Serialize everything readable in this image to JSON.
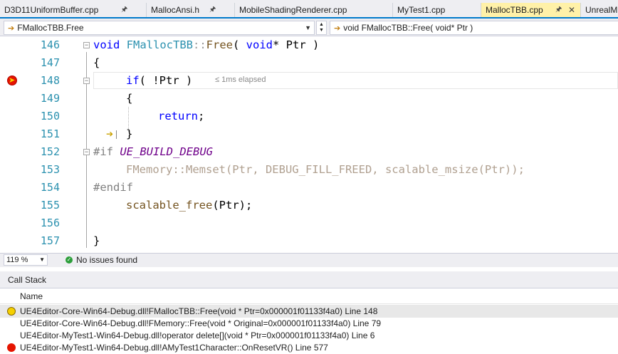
{
  "tabs": [
    {
      "label": "D3D11UniformBuffer.cpp",
      "pinned": true,
      "active": false
    },
    {
      "label": "MallocAnsi.h",
      "pinned": true,
      "active": false
    },
    {
      "label": "MobileShadingRenderer.cpp",
      "pinned": false,
      "active": false
    },
    {
      "label": "MyTest1.cpp",
      "pinned": false,
      "active": false
    },
    {
      "label": "MallocTBB.cpp",
      "pinned": true,
      "active": true
    },
    {
      "label": "UnrealM",
      "pinned": false,
      "active": false
    }
  ],
  "icons": {
    "pin": "pin-icon",
    "close": "close-icon",
    "nav_scope": "arrow-right-icon",
    "dropdown": "chevron-down-icon"
  },
  "nav": {
    "scope": "FMallocTBB.Free",
    "member": "void FMallocTBB::Free( void* Ptr )"
  },
  "editor": {
    "lines": [
      {
        "n": "146"
      },
      {
        "n": "147"
      },
      {
        "n": "148"
      },
      {
        "n": "149"
      },
      {
        "n": "150"
      },
      {
        "n": "151"
      },
      {
        "n": "152"
      },
      {
        "n": "153"
      },
      {
        "n": "154"
      },
      {
        "n": "155"
      },
      {
        "n": "156"
      },
      {
        "n": "157"
      }
    ],
    "elapsed_hint": "≤ 1ms elapsed"
  },
  "code": {
    "l146": {
      "kw1": "void",
      "cls": "FMallocTBB",
      "sep": "::",
      "fn": "Free",
      "rest1": "( ",
      "kw2": "void",
      "rest2": "* Ptr )"
    },
    "l147": "{",
    "l148": {
      "kw": "if",
      "rest": "( !Ptr )"
    },
    "l149": "{",
    "l150": {
      "kw": "return",
      "rest": ";"
    },
    "l151": "}",
    "l152": {
      "pre": "#if",
      "mac": "UE_BUILD_DEBUG"
    },
    "l153": "FMemory::Memset(Ptr, DEBUG_FILL_FREED, scalable_msize(Ptr));",
    "l154": "#endif",
    "l155": {
      "fn": "scalable_free",
      "rest": "(Ptr);"
    },
    "l157": "}"
  },
  "status": {
    "zoom": "119 %",
    "issues": "No issues found"
  },
  "colors": {
    "accent": "#007acc",
    "active_tab": "#fff1a8",
    "keyword": "#0000ff",
    "type": "#2b91af",
    "breakpoint": "#e51400",
    "current": "#f5d000"
  },
  "callstack": {
    "title": "Call Stack",
    "column": "Name",
    "rows": [
      {
        "text": "UE4Editor-Core-Win64-Debug.dll!FMallocTBB::Free(void * Ptr=0x000001f01133f4a0) Line 148",
        "marker": "current"
      },
      {
        "text": "UE4Editor-Core-Win64-Debug.dll!FMemory::Free(void * Original=0x000001f01133f4a0) Line 79",
        "marker": "none"
      },
      {
        "text": "UE4Editor-MyTest1-Win64-Debug.dll!operator delete[](void * Ptr=0x000001f01133f4a0) Line 6",
        "marker": "none"
      },
      {
        "text": "UE4Editor-MyTest1-Win64-Debug.dll!AMyTest1Character::OnResetVR() Line 577",
        "marker": "breakpoint"
      }
    ]
  }
}
